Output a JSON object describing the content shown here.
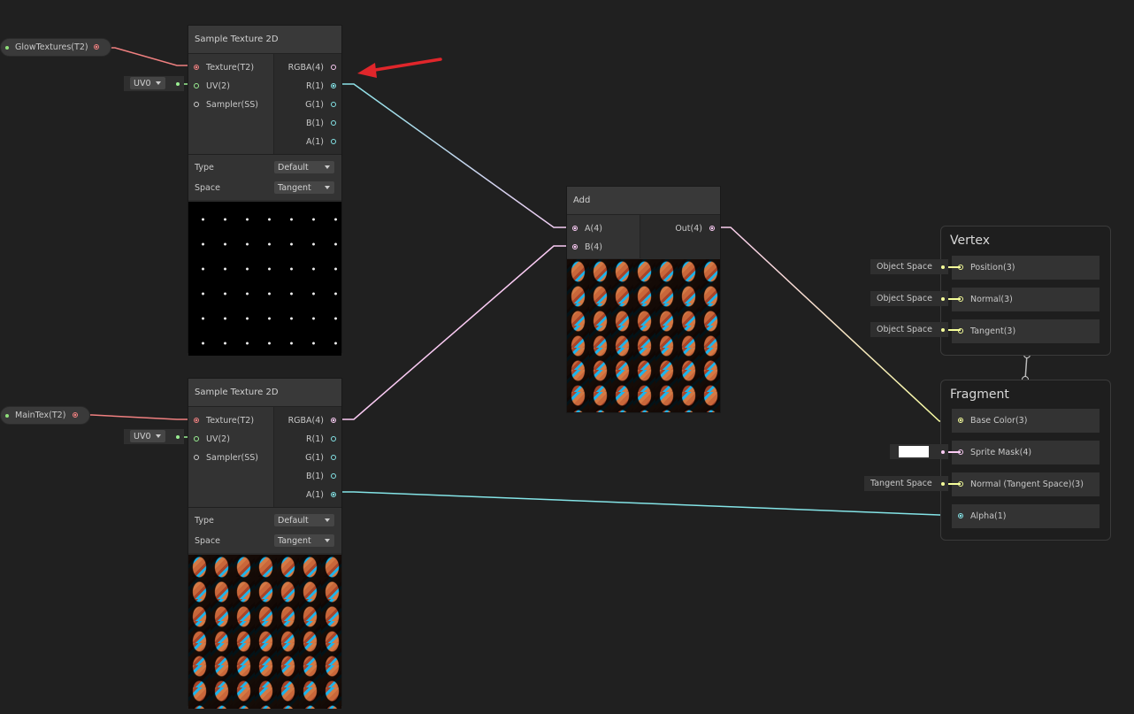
{
  "properties": [
    {
      "label": "GlowTextures(T2)",
      "color": "#f08080"
    },
    {
      "label": "MainTex(T2)",
      "color": "#f08080"
    }
  ],
  "nodes": [
    {
      "title": "Sample Texture 2D",
      "inputs": [
        "Texture(T2)",
        "UV(2)",
        "Sampler(SS)"
      ],
      "outputs": [
        "RGBA(4)",
        "R(1)",
        "G(1)",
        "B(1)",
        "A(1)"
      ],
      "uv": "UV0",
      "type_label": "Type",
      "type_value": "Default",
      "space_label": "Space",
      "space_value": "Tangent",
      "preview": "glow-texture"
    },
    {
      "title": "Sample Texture 2D",
      "inputs": [
        "Texture(T2)",
        "UV(2)",
        "Sampler(SS)"
      ],
      "outputs": [
        "RGBA(4)",
        "R(1)",
        "G(1)",
        "B(1)",
        "A(1)"
      ],
      "uv": "UV0",
      "type_label": "Type",
      "type_value": "Default",
      "space_label": "Space",
      "space_value": "Tangent",
      "preview": "main-texture"
    }
  ],
  "add_node": {
    "title": "Add",
    "inputs": [
      "A(4)",
      "B(4)"
    ],
    "outputs": [
      "Out(4)"
    ]
  },
  "vertex": {
    "title": "Vertex",
    "slots": [
      {
        "label": "Position(3)",
        "default": "Object Space"
      },
      {
        "label": "Normal(3)",
        "default": "Object Space"
      },
      {
        "label": "Tangent(3)",
        "default": "Object Space"
      }
    ]
  },
  "fragment": {
    "title": "Fragment",
    "slots": [
      {
        "label": "Base Color(3)",
        "default": ""
      },
      {
        "label": "Sprite Mask(4)",
        "default": "#ffffff"
      },
      {
        "label": "Normal (Tangent Space)(3)",
        "default": "Tangent Space"
      },
      {
        "label": "Alpha(1)",
        "default": ""
      }
    ]
  },
  "colors": {
    "texture": "#f08080",
    "vector1": "#84e4e7",
    "vector4": "#fbcbf4",
    "vector3": "#f6ff9a",
    "vector2": "#9aef92",
    "annotation_arrow": "#e0262b"
  }
}
